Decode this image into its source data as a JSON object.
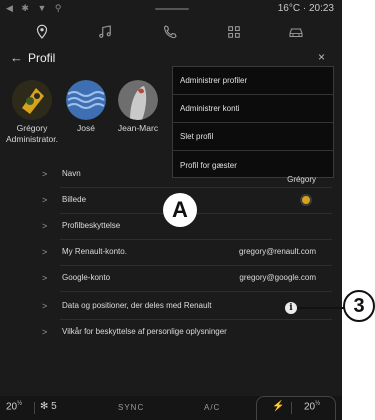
{
  "status": {
    "left_icons": "◀ ✱ ▼ ⚲",
    "right": "16°C · 20:23"
  },
  "topnav": {
    "icons": [
      "location-pin-icon",
      "music-notes-icon",
      "phone-icon",
      "grid-apps-icon",
      "car-icon"
    ]
  },
  "header": {
    "back": "←",
    "title": "Profil",
    "close": "×"
  },
  "profiles": [
    {
      "name": "Grégory\nAdministrator.",
      "avatar_color": "#d8a21a"
    },
    {
      "name": "José",
      "avatar_color": "#5a86c8"
    },
    {
      "name": "Jean-Marc",
      "avatar_color": "#b7b7b7"
    }
  ],
  "menu": [
    "Administrer profiler",
    "Administrer konti",
    "Slet profil",
    "Profil for gæster"
  ],
  "rows": [
    {
      "label": "Navn",
      "value": "Grégory"
    },
    {
      "label": "Billede",
      "value": ""
    },
    {
      "label": "Profilbeskyttelse",
      "value": ""
    },
    {
      "label": "My Renault-konto.",
      "value": "gregory@renault.com"
    },
    {
      "label": "Google-konto",
      "value": "gregory@google.com"
    },
    {
      "label": "Data og positioner, der deles med Renault",
      "value": ""
    },
    {
      "label": "Vilkår for beskyttelse af personlige oplysninger",
      "value": ""
    }
  ],
  "callouts": {
    "a": "A",
    "three": "3",
    "info": "i"
  },
  "bottombar": {
    "left_temp": "20",
    "left_temp_suffix": "½",
    "fan": "5",
    "sync": "SYNC",
    "ac": "A/C",
    "right_temp": "20",
    "right_temp_suffix": "½"
  },
  "colors": {
    "background": "#1b1b1b",
    "menu_bg": "#0c0c0c",
    "text": "#e6e6e6"
  }
}
